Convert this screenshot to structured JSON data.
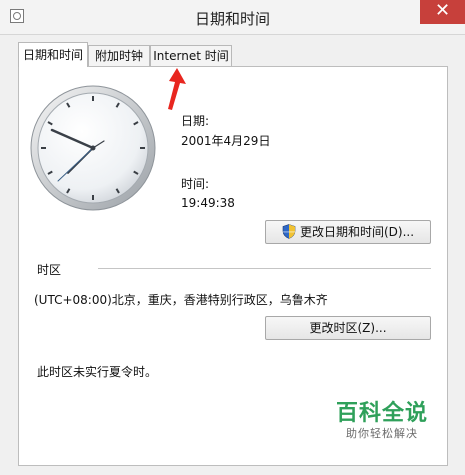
{
  "window": {
    "title": "日期和时间",
    "close": "✕"
  },
  "tabs": [
    {
      "label": "日期和时间",
      "active": true
    },
    {
      "label": "附加时钟",
      "active": false
    },
    {
      "label": "Internet 时间",
      "active": false
    }
  ],
  "date_section": {
    "date_label": "日期:",
    "date_value": "2001年4月29日",
    "time_label": "时间:",
    "time_value": "19:49:38"
  },
  "buttons": {
    "change_datetime": "更改日期和时间(D)...",
    "change_timezone": "更改时区(Z)..."
  },
  "timezone": {
    "heading": "时区",
    "value": "(UTC+08:00)北京，重庆，香港特别行政区，乌鲁木齐",
    "dst_note": "此时区未实行夏令时。"
  },
  "watermark": {
    "main": "百科全说",
    "sub": "助你轻松解决"
  },
  "colors": {
    "close_button": "#c7403b",
    "arrow": "#e8261f",
    "watermark": "#2fa05a"
  }
}
